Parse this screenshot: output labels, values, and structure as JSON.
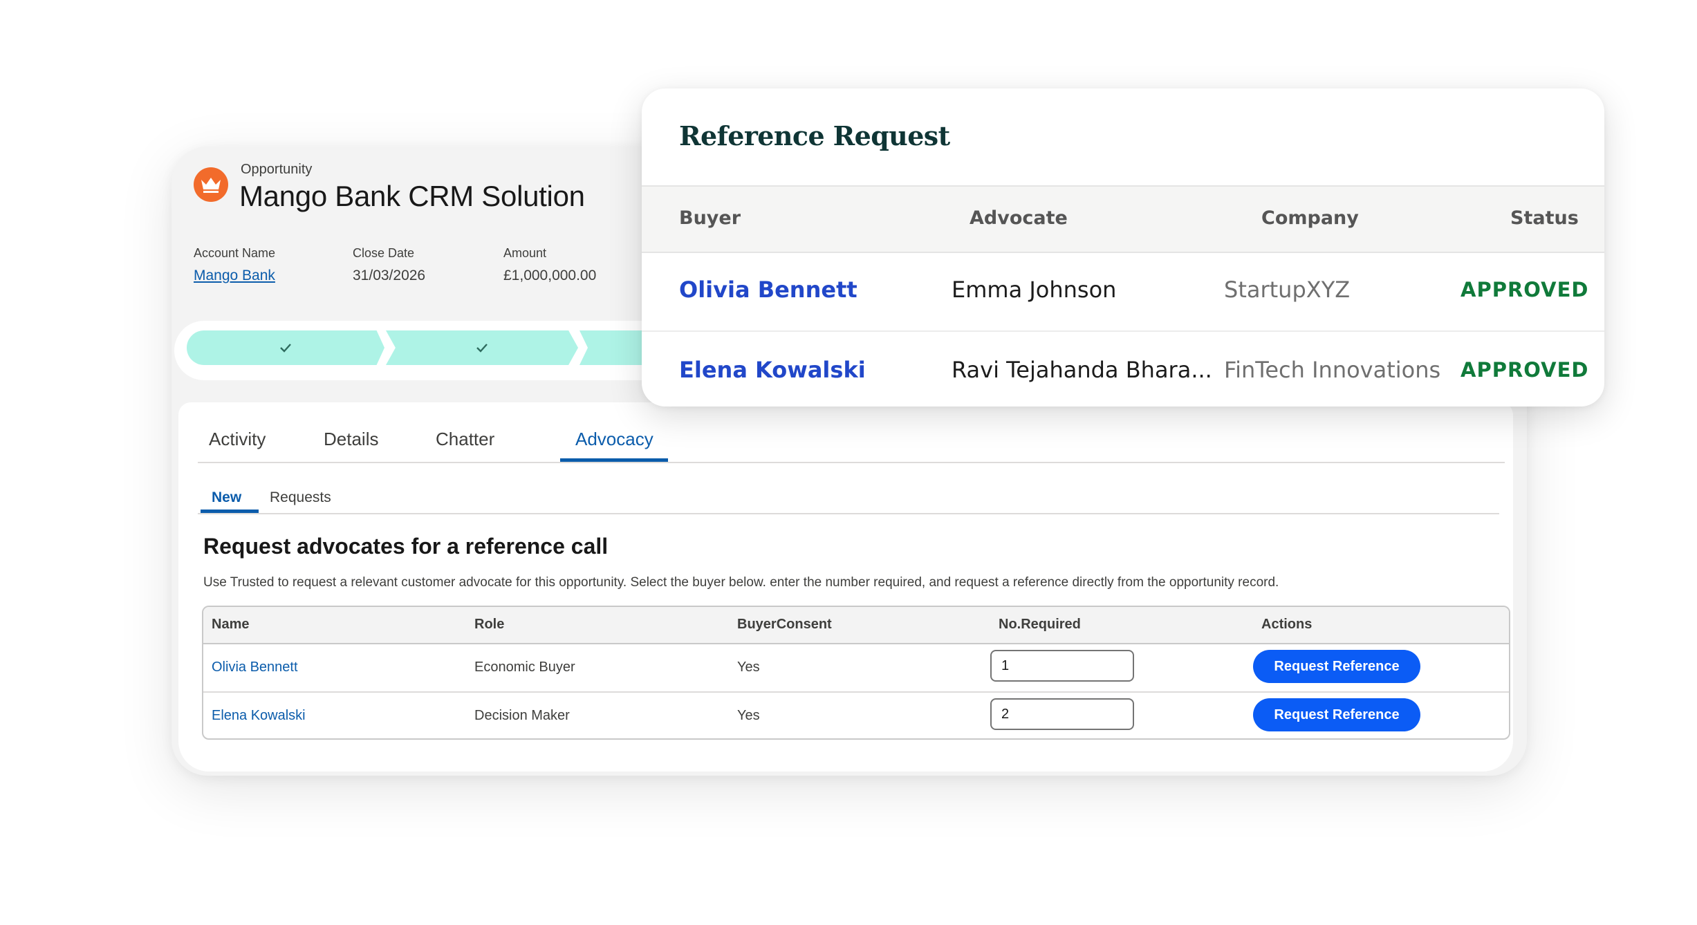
{
  "record": {
    "object_label": "Opportunity",
    "title": "Mango Bank CRM Solution",
    "fields": [
      {
        "label": "Account Name",
        "value": "Mango Bank"
      },
      {
        "label": "Close Date",
        "value": "31/03/2026"
      },
      {
        "label": "Amount",
        "value": "£1,000,000.00"
      }
    ],
    "brand_color": "#f26b2b",
    "path_color": "#aef3e6"
  },
  "tabs": [
    "Activity",
    "Details",
    "Chatter",
    "Advocacy"
  ],
  "active_tab": "Advocacy",
  "subtabs": [
    "New",
    "Requests"
  ],
  "active_subtab": "New",
  "section": {
    "title": "Request advocates for a reference call",
    "description": "Use Trusted to request a relevant customer advocate for this opportunity. Select the buyer below. enter the number required, and request a reference directly from the opportunity record."
  },
  "advocate_table": {
    "headers": [
      "Name",
      "Role",
      "BuyerConsent",
      "No.Required",
      "Actions"
    ],
    "rows": [
      {
        "name": "Olivia Bennett",
        "role": "Economic Buyer",
        "consent": "Yes",
        "required": "1",
        "action": "Request Reference"
      },
      {
        "name": "Elena Kowalski",
        "role": "Decision Maker",
        "consent": "Yes",
        "required": "2",
        "action": "Request Reference"
      }
    ]
  },
  "reference_request": {
    "title": "Reference Request",
    "headers": [
      "Buyer",
      "Advocate",
      "Company",
      "Status"
    ],
    "rows": [
      {
        "buyer": "Olivia Bennett",
        "advocate": "Emma Johnson",
        "company": "StartupXYZ",
        "status": "APPROVED"
      },
      {
        "buyer": "Elena Kowalski",
        "advocate": "Ravi Tejahanda Bhara...",
        "company": "FinTech Innovations",
        "status": "APPROVED"
      }
    ],
    "status_color": "#107a3a",
    "link_color": "#2147c9"
  },
  "accent_color": "#0b5cab",
  "button_color": "#0b5cf5"
}
